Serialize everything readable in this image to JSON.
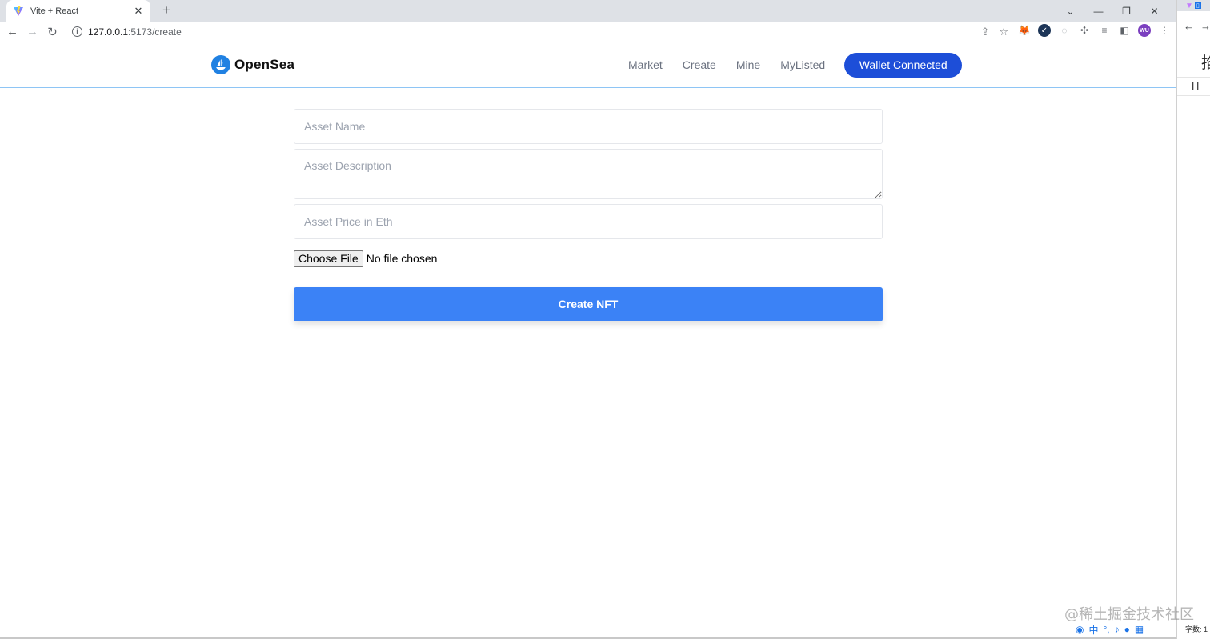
{
  "browser": {
    "tab_title": "Vite + React",
    "tab_close": "✕",
    "new_tab": "+",
    "url_host": "127.0.0.1",
    "url_path": ":5173/create",
    "window_controls": {
      "dropdown": "⌄",
      "minimize": "—",
      "restore": "❐",
      "close": "✕"
    },
    "extension_avatar": "WU"
  },
  "side_window": {
    "char": "掐",
    "h_label": "H",
    "word_count": "字数: 1"
  },
  "navbar": {
    "brand": "OpenSea",
    "links": [
      "Market",
      "Create",
      "Mine",
      "MyListed"
    ],
    "wallet_button": "Wallet Connected"
  },
  "form": {
    "name_placeholder": "Asset Name",
    "description_placeholder": "Asset Description",
    "price_placeholder": "Asset Price in Eth",
    "choose_file_label": "Choose File",
    "file_status": "No file chosen",
    "submit_label": "Create NFT"
  },
  "watermark": "@稀土掘金技术社区",
  "colors": {
    "wallet_button": "#1d4ed8",
    "create_button": "#3b82f6",
    "brand_logo": "#2081e2",
    "nav_border": "#8ec5f5"
  }
}
